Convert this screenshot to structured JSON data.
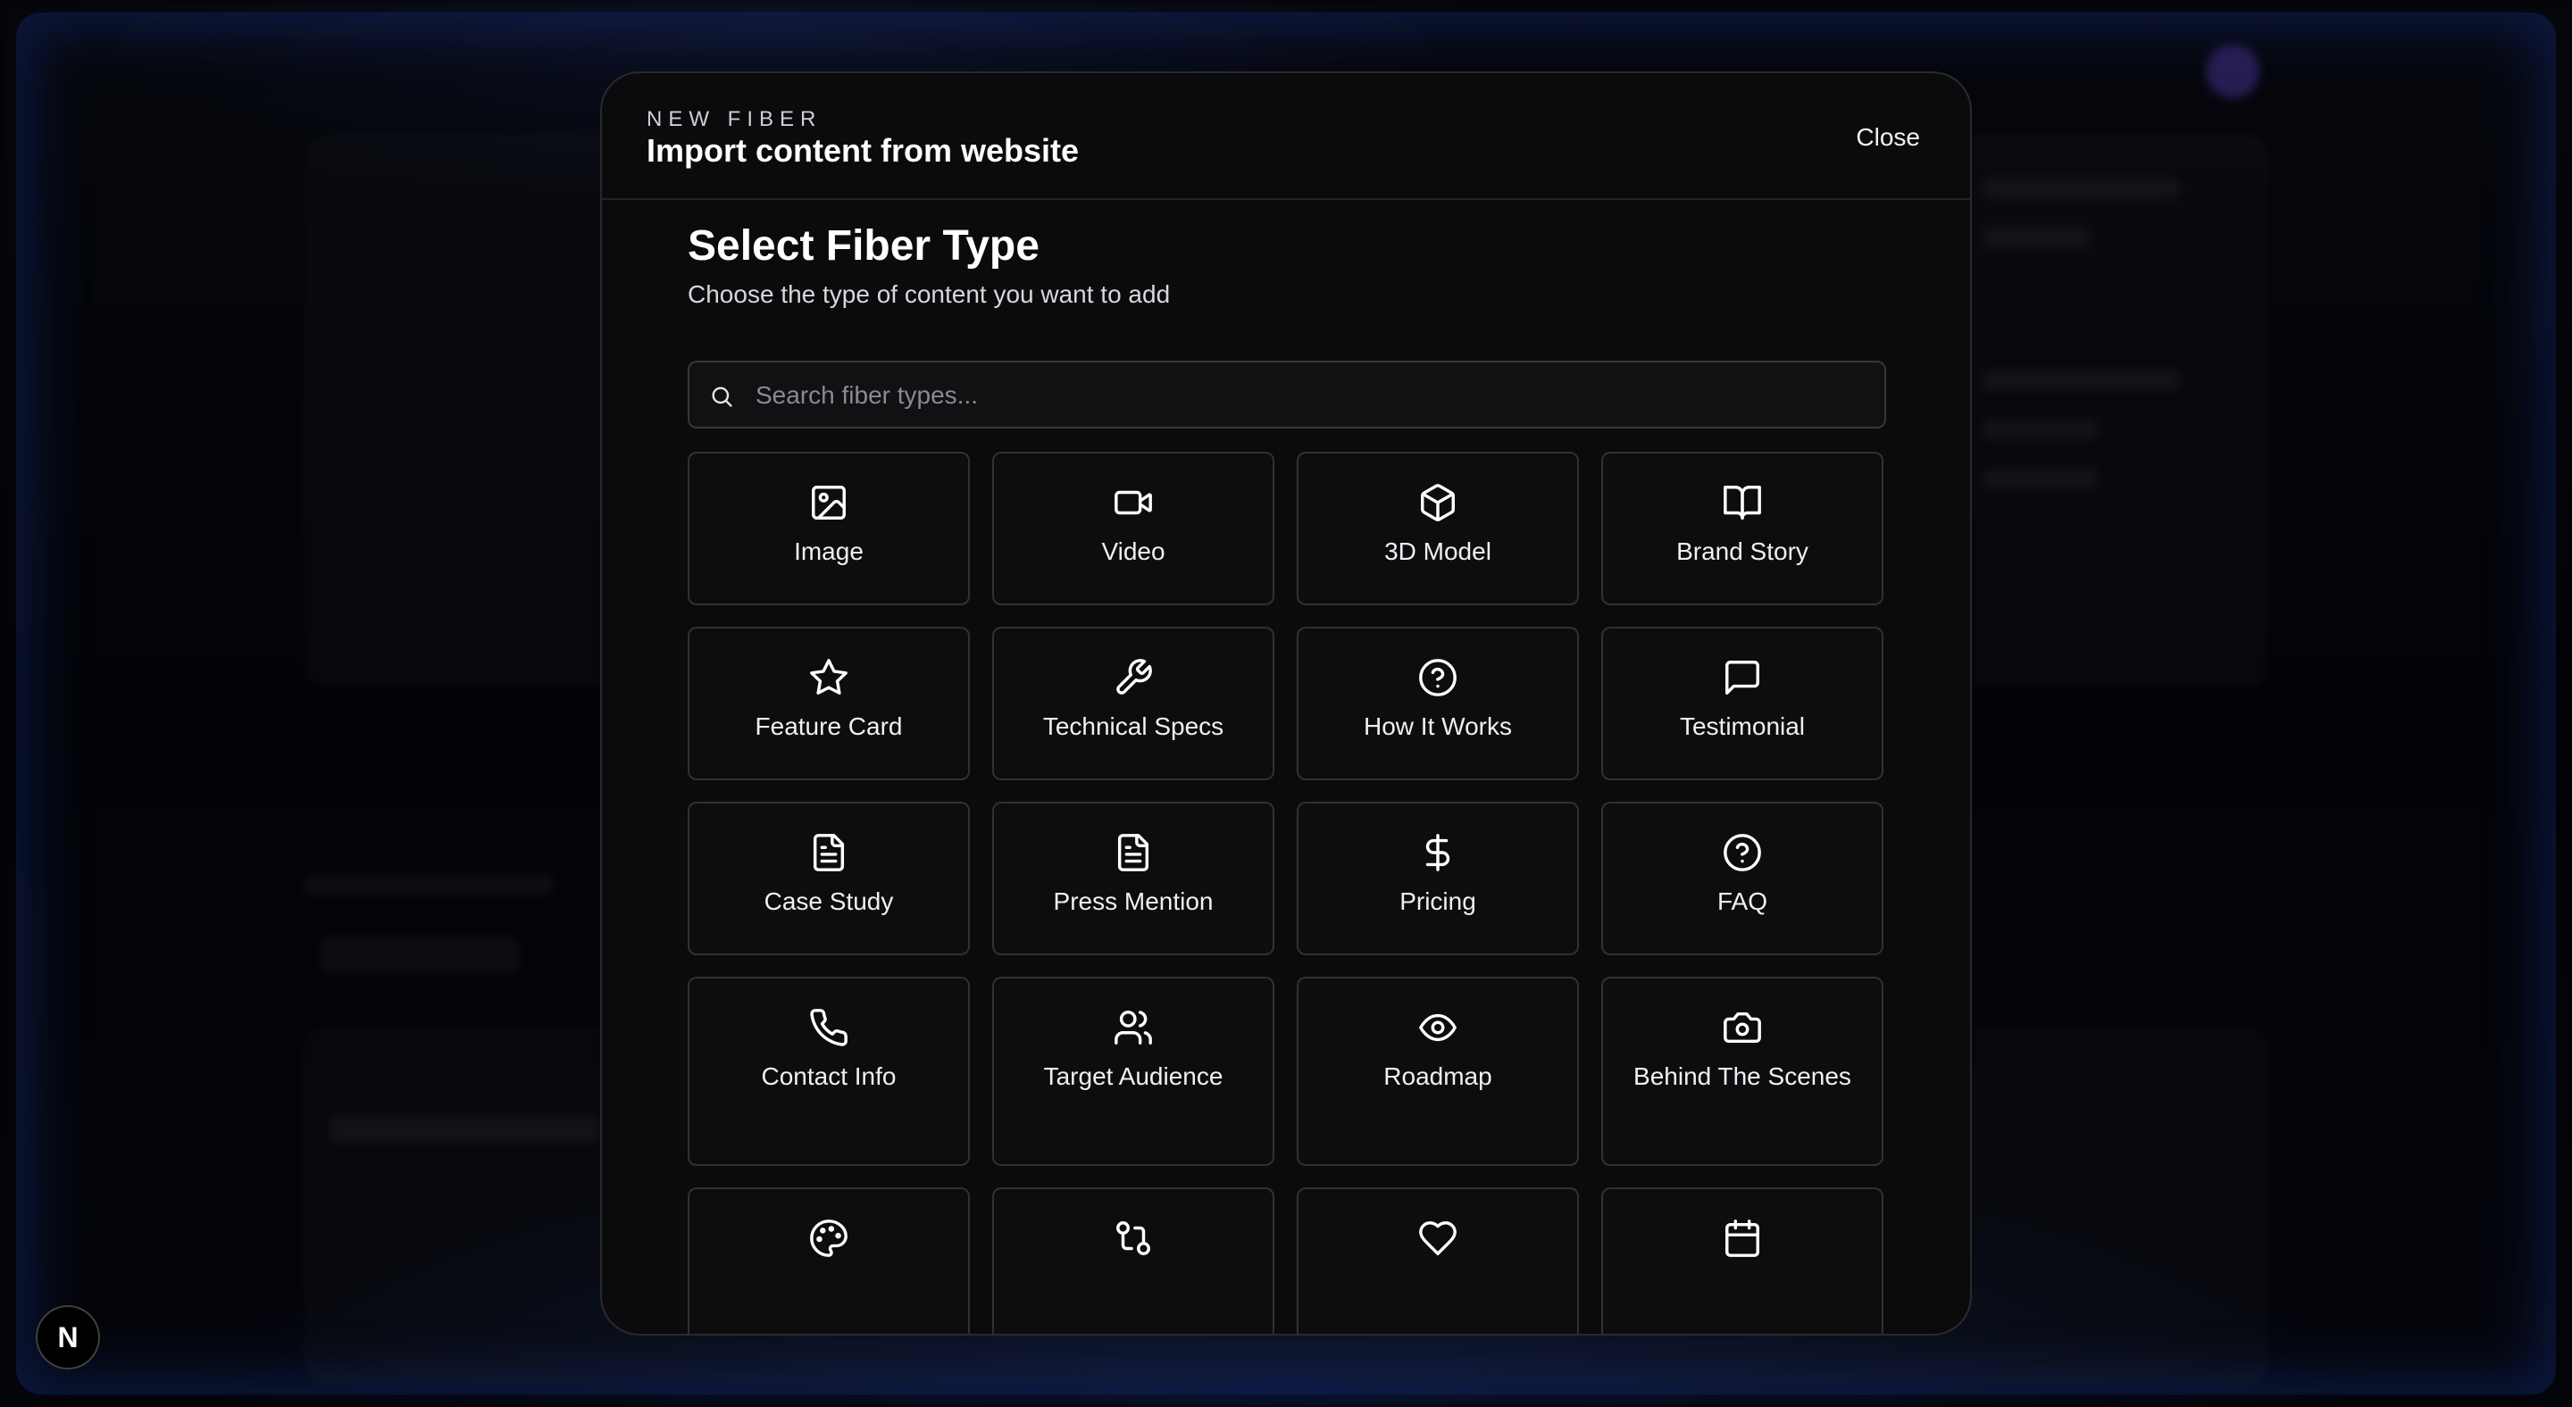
{
  "modal": {
    "eyebrow": "NEW FIBER",
    "title": "Import content from website",
    "close_label": "Close"
  },
  "picker": {
    "title": "Select Fiber Type",
    "subtitle": "Choose the type of content you want to add",
    "search_placeholder": "Search fiber types..."
  },
  "fiber_types": [
    {
      "label": "Image",
      "icon": "image-icon"
    },
    {
      "label": "Video",
      "icon": "video-icon"
    },
    {
      "label": "3D Model",
      "icon": "box-icon"
    },
    {
      "label": "Brand Story",
      "icon": "book-open-icon"
    },
    {
      "label": "Feature Card",
      "icon": "star-icon"
    },
    {
      "label": "Technical Specs",
      "icon": "wrench-icon"
    },
    {
      "label": "How It Works",
      "icon": "help-circle-icon"
    },
    {
      "label": "Testimonial",
      "icon": "message-square-icon"
    },
    {
      "label": "Case Study",
      "icon": "file-text-icon"
    },
    {
      "label": "Press Mention",
      "icon": "file-text-icon"
    },
    {
      "label": "Pricing",
      "icon": "dollar-sign-icon"
    },
    {
      "label": "FAQ",
      "icon": "help-circle-icon"
    },
    {
      "label": "Contact Info",
      "icon": "phone-icon"
    },
    {
      "label": "Target Audience",
      "icon": "users-icon"
    },
    {
      "label": "Roadmap",
      "icon": "eye-icon"
    },
    {
      "label": "Behind The Scenes",
      "icon": "camera-icon"
    },
    {
      "label": "",
      "icon": "palette-icon"
    },
    {
      "label": "",
      "icon": "git-pull-request-icon"
    },
    {
      "label": "",
      "icon": "heart-icon"
    },
    {
      "label": "",
      "icon": "calendar-icon"
    }
  ],
  "dev_badge": "N"
}
